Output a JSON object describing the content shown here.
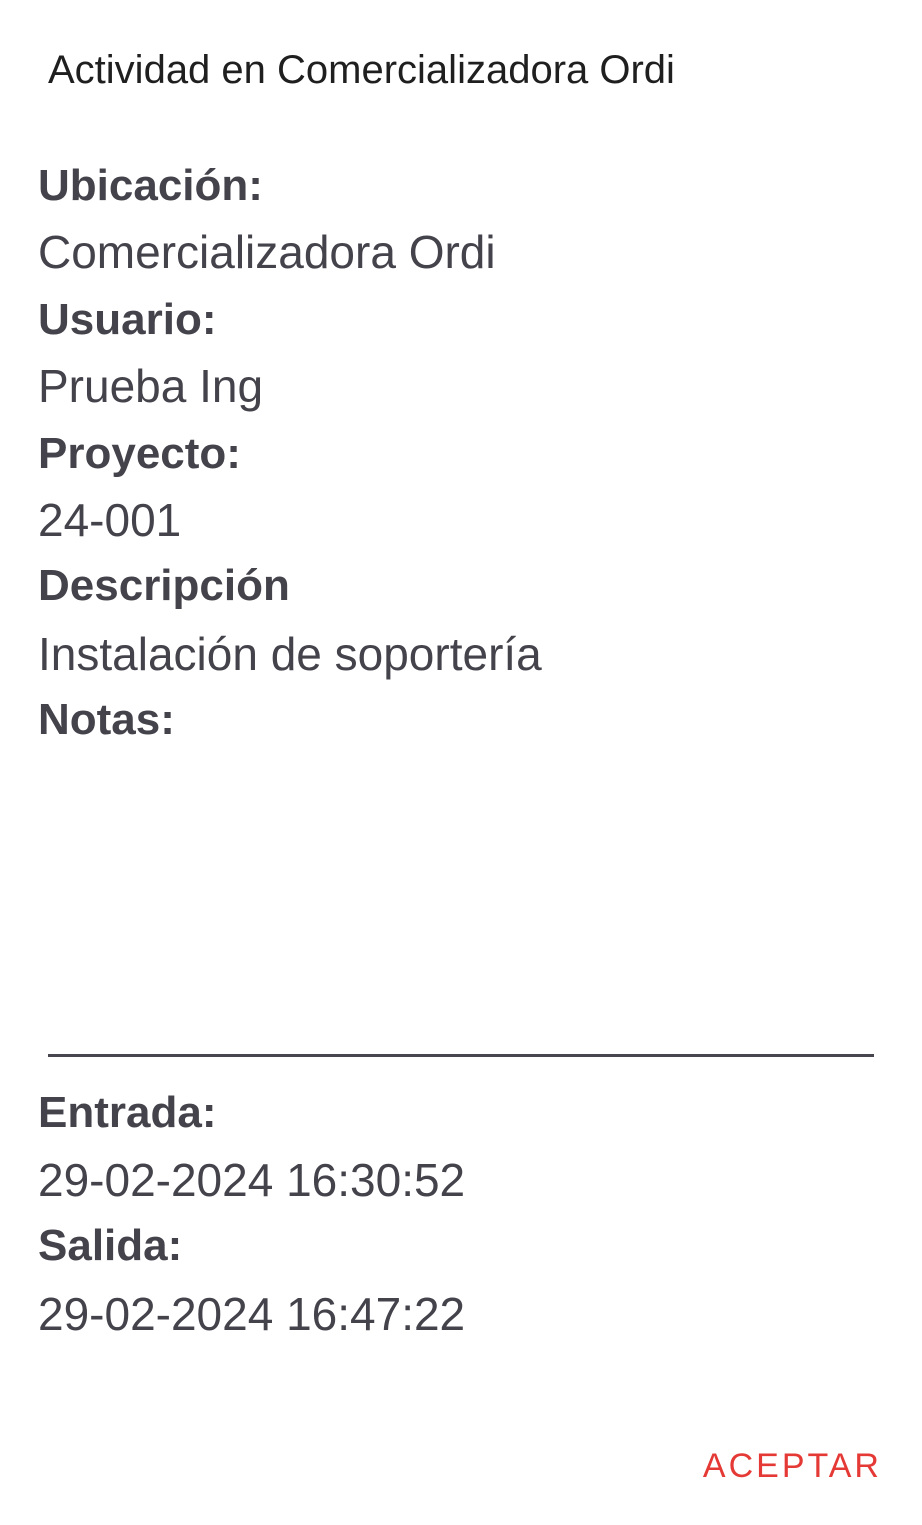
{
  "dialog": {
    "title": "Actividad en Comercializadora Ordi",
    "fields": {
      "ubicacion": {
        "label": "Ubicación:",
        "value": "Comercializadora Ordi"
      },
      "usuario": {
        "label": "Usuario:",
        "value": "Prueba Ing"
      },
      "proyecto": {
        "label": "Proyecto:",
        "value": "24-001"
      },
      "descripcion": {
        "label": "Descripción",
        "value": "Instalación de soportería"
      },
      "notas": {
        "label": "Notas:",
        "value": ""
      },
      "entrada": {
        "label": "Entrada:",
        "value": "29-02-2024 16:30:52"
      },
      "salida": {
        "label": "Salida:",
        "value": "29-02-2024 16:47:22"
      }
    },
    "actions": {
      "accept_label": "ACEPTAR"
    }
  },
  "colors": {
    "text_primary": "#1f1f1f",
    "text_field": "#44434b",
    "accent": "#e53935"
  }
}
